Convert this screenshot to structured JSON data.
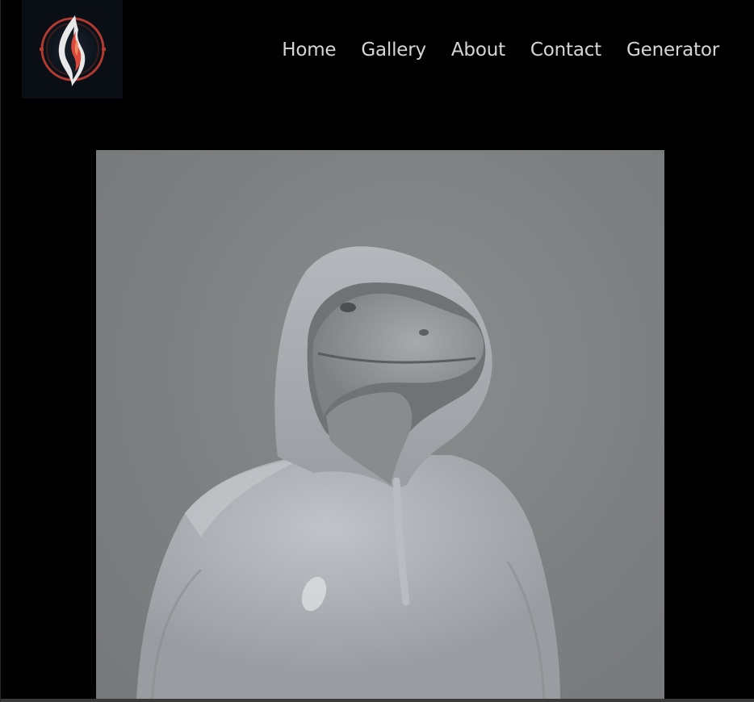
{
  "logo": {
    "icon": "flame-emblem-icon",
    "colors": {
      "ring": "#b23a30",
      "flame_red": "#d94a3c",
      "flame_white": "#e8e8e8",
      "background": "#0a0f16"
    }
  },
  "nav": {
    "items": [
      {
        "label": "Home"
      },
      {
        "label": "Gallery"
      },
      {
        "label": "About"
      },
      {
        "label": "Contact"
      },
      {
        "label": "Generator"
      }
    ]
  },
  "hero": {
    "subject": "hooded-reptile-sculpture-image",
    "colors": {
      "background": "#7f8283",
      "figure": "#a9adb1"
    }
  },
  "theme": {
    "page_background": "#000000",
    "nav_text": "#d6d6d6"
  }
}
